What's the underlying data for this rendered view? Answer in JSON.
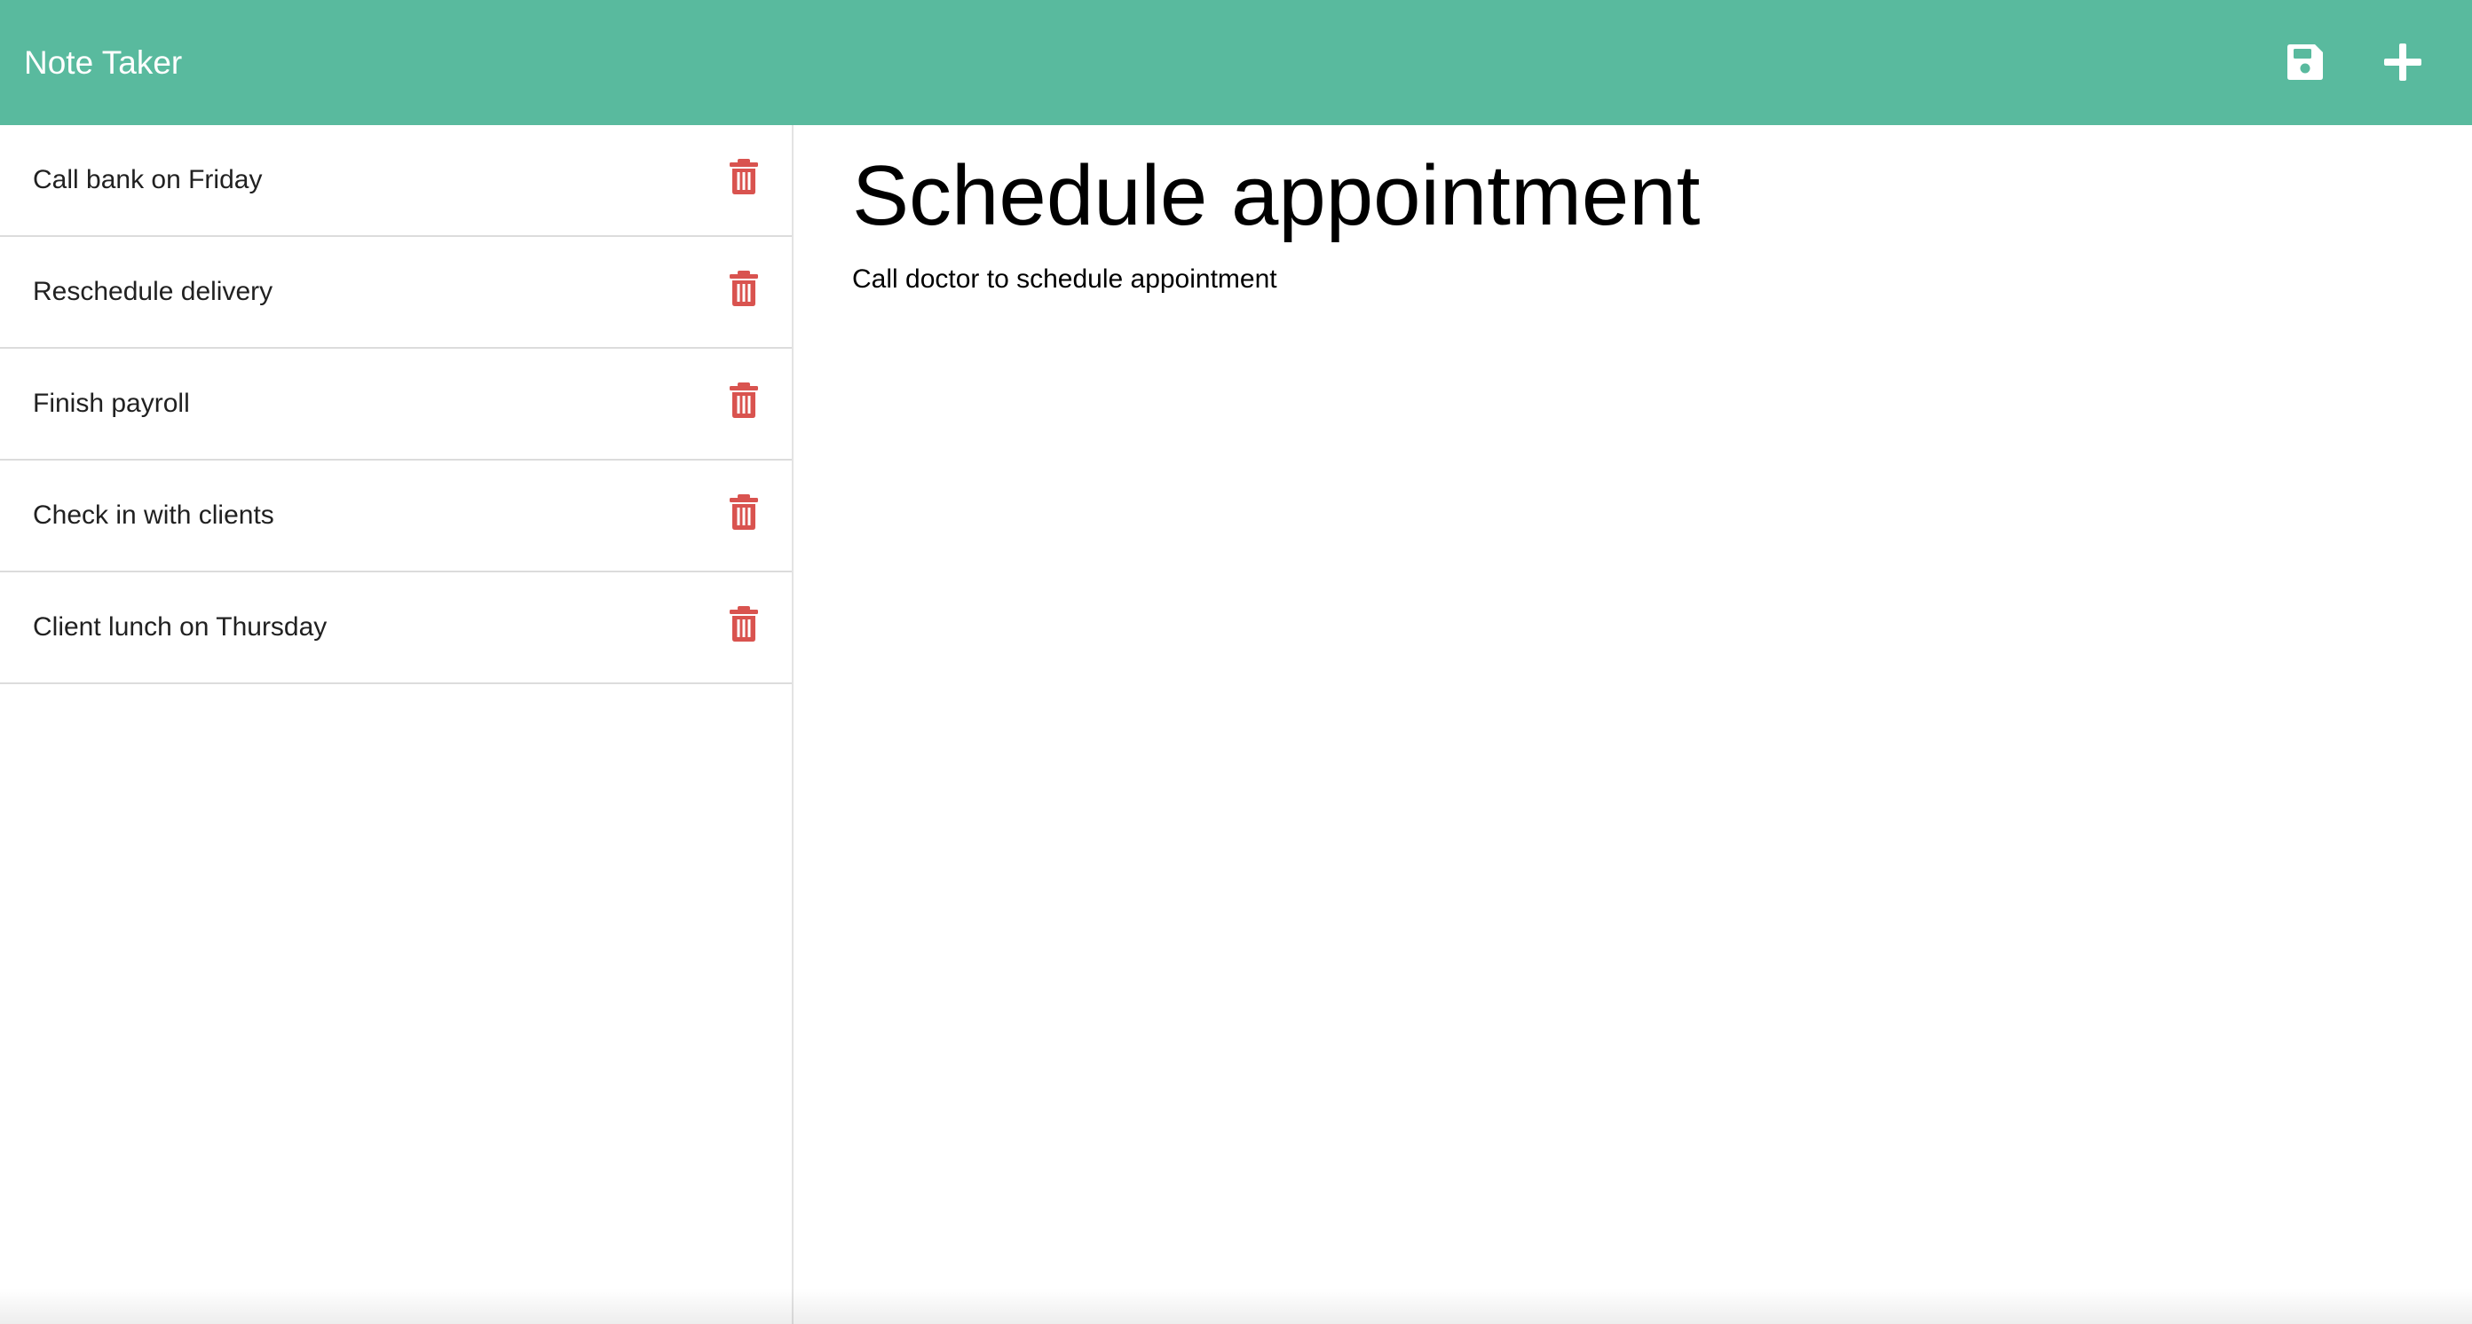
{
  "navbar": {
    "brand": "Note Taker",
    "save_icon": "floppy-disk-icon",
    "new_icon": "plus-icon",
    "background_color": "#59ba9e"
  },
  "notes": [
    {
      "title": "Call bank on Friday"
    },
    {
      "title": "Reschedule delivery"
    },
    {
      "title": "Finish payroll"
    },
    {
      "title": "Check in with clients"
    },
    {
      "title": "Client lunch on Thursday"
    }
  ],
  "delete_icon": "trash-icon",
  "delete_color": "#d9534f",
  "active_note": {
    "title": "Schedule appointment",
    "text": "Call doctor to schedule appointment"
  }
}
